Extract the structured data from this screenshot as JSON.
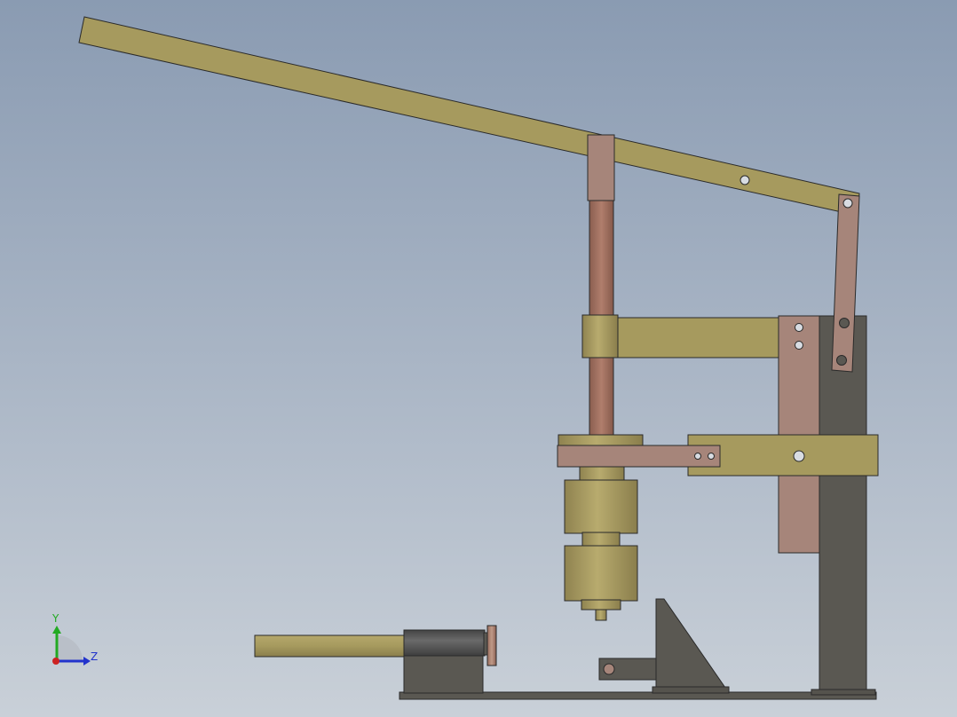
{
  "colors": {
    "background_top": "#8a9bb2",
    "background_bottom": "#c9d0d8",
    "brass": "#a69a5e",
    "brass_dark": "#8f8350",
    "copper": "#a6857a",
    "copper_rod": "#9c6e5e",
    "steel_dark": "#5a5852",
    "steel_mid": "#6a6862",
    "outline": "#2a2a2a"
  },
  "triad": {
    "y_axis_label": "Y",
    "z_axis_label": "Z",
    "y_axis_color": "#22aa22",
    "z_axis_color": "#2233cc",
    "x_axis_color": "#cc2222"
  }
}
